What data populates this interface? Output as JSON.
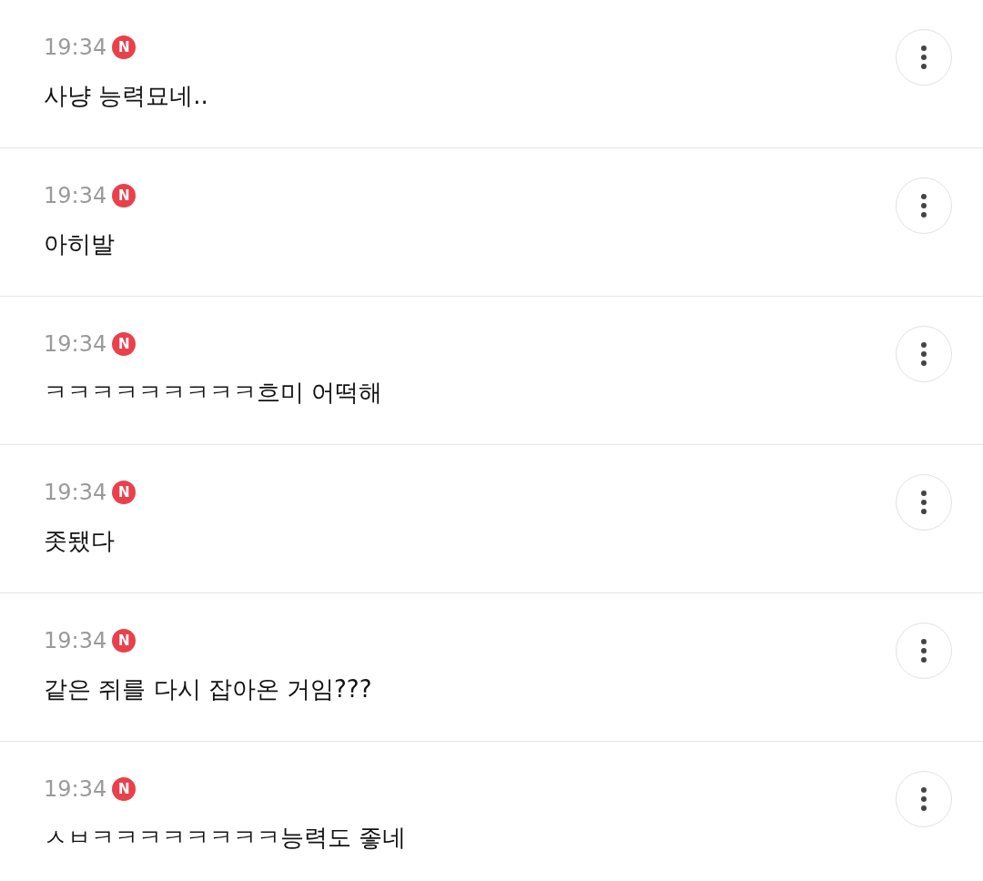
{
  "comments": [
    {
      "time": "19:34",
      "badge": "N",
      "text": "사냥 능력묘네.."
    },
    {
      "time": "19:34",
      "badge": "N",
      "text": "아히발"
    },
    {
      "time": "19:34",
      "badge": "N",
      "text": "ㅋㅋㅋㅋㅋㅋㅋㅋㅋ흐미 어떡해"
    },
    {
      "time": "19:34",
      "badge": "N",
      "text": "좃됐다"
    },
    {
      "time": "19:34",
      "badge": "N",
      "text": "같은 쥐를 다시 잡아온 거임???"
    },
    {
      "time": "19:34",
      "badge": "N",
      "text": "ㅅㅂㅋㅋㅋㅋㅋㅋㅋㅋ능력도 좋네"
    }
  ]
}
